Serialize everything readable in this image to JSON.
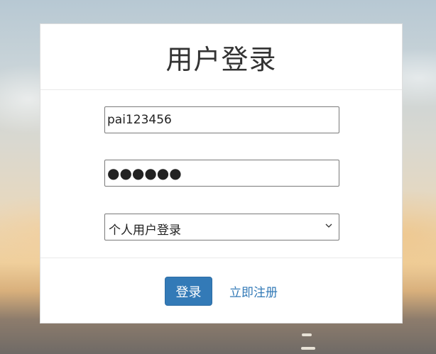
{
  "login": {
    "title": "用户登录",
    "username_value": "pai123456",
    "password_display": "●●●●●●",
    "account_type_selected": "个人用户登录",
    "login_button_label": "登录",
    "register_link_label": "立即注册"
  },
  "colors": {
    "primary": "#337ab7",
    "panel_background": "#ffffff"
  },
  "icons": {
    "select_arrow": "chevron-down-icon"
  }
}
